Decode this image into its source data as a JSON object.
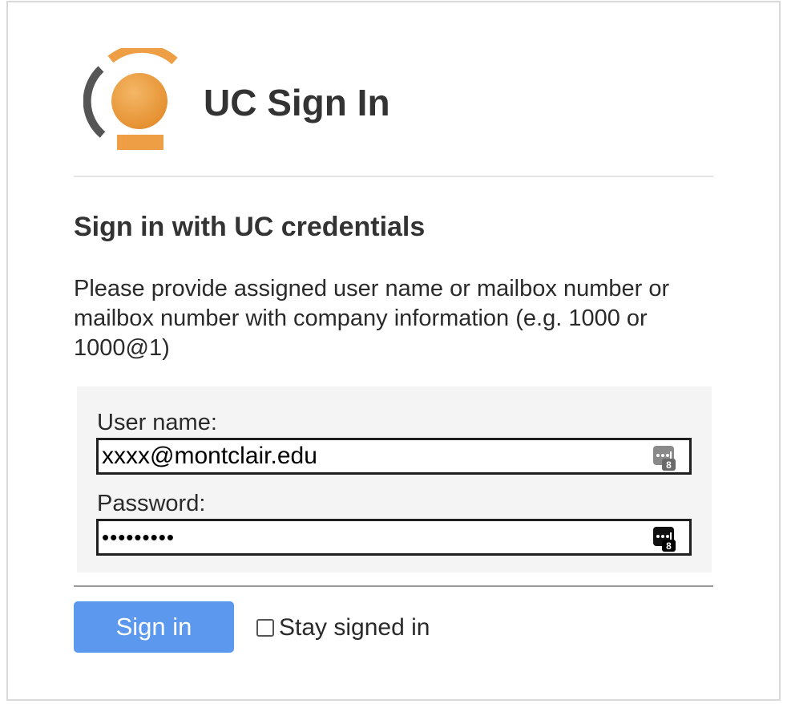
{
  "header": {
    "title": "UC Sign In",
    "logo_icon": "uc-logo-icon"
  },
  "form": {
    "heading": "Sign in with UC credentials",
    "instructions": "Please provide assigned user name or mailbox number or mailbox number with company information (e.g. 1000 or 1000@1)",
    "username_label": "User name:",
    "username_value": "xxxx@montclair.edu",
    "password_label": "Password:",
    "password_value": "xxxxxxxxx",
    "password_manager_icon": "password-manager-icon",
    "signin_label": "Sign in",
    "stay_signed_in_label": "Stay signed in",
    "stay_signed_in_checked": false
  },
  "colors": {
    "button": "#5b98ee",
    "logo_orange": "#e89a3c",
    "logo_gray": "#5a5a5a"
  }
}
